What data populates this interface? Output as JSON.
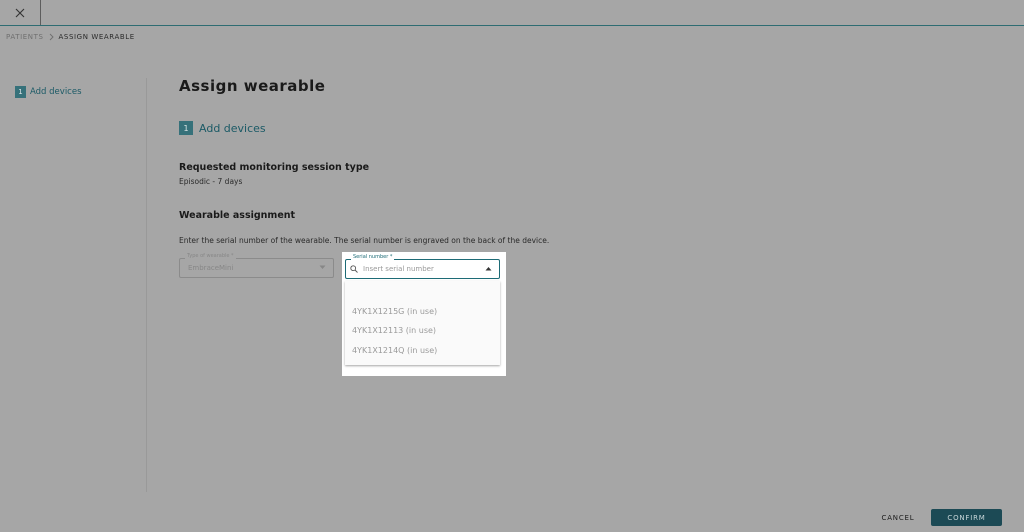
{
  "breadcrumb": {
    "parent": "PATIENTS",
    "current": "ASSIGN WEARABLE"
  },
  "sidebar": {
    "step_number": "1",
    "step_label": "Add devices"
  },
  "page": {
    "title": "Assign wearable",
    "step_number": "1",
    "step_label": "Add devices"
  },
  "session": {
    "title": "Requested monitoring session type",
    "value": "Episodic - 7 days"
  },
  "assignment": {
    "title": "Wearable assignment",
    "helper": "Enter the serial number of the wearable. The serial number is engraved on the back of the device.",
    "type_field": {
      "label": "Type of wearable *",
      "value": "EmbraceMini"
    },
    "serial_field": {
      "label": "Serial number *",
      "placeholder": "Insert serial number",
      "value": "",
      "options": [
        "4YK1X1215G (in use)",
        "4YK1X12113 (in use)",
        "4YK1X1214Q (in use)"
      ]
    }
  },
  "footer": {
    "cancel_label": "CANCEL",
    "confirm_label": "CONFIRM"
  },
  "icons": {
    "close": "close-icon",
    "breadcrumb_sep": "chevron-right-icon",
    "search": "search-icon",
    "select_caret": "caret-down-icon",
    "dropdown_caret": "caret-up-icon"
  },
  "colors": {
    "overlay_bg": "#a6a6a6",
    "accent": "#1d6b76",
    "confirm_bg": "#1c4a55",
    "badge": "#36717a"
  }
}
